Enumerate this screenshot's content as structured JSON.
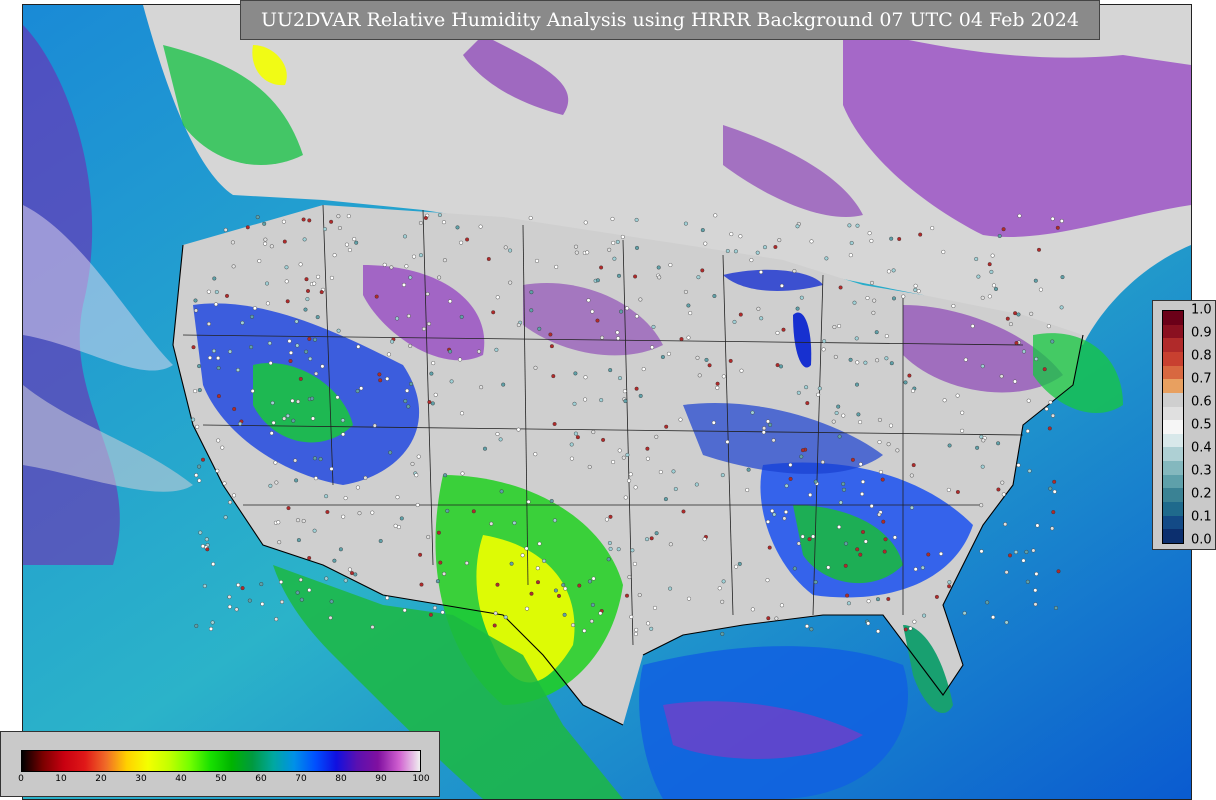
{
  "title": "UU2DVAR Relative Humidity Analysis using HRRR Background 07 UTC 04 Feb 2024",
  "map": {
    "land_color": "#cfcfcf",
    "ocean_gradient": [
      "#1a8ad6",
      "#2bb3c9",
      "#0a5bd0"
    ],
    "station_marker_color": "#ffffff"
  },
  "bottom_legend": {
    "ticks": [
      "0",
      "10",
      "20",
      "30",
      "40",
      "50",
      "60",
      "70",
      "80",
      "90",
      "100"
    ],
    "colors": [
      "#000000",
      "#7a0000",
      "#c80010",
      "#e01818",
      "#f06a28",
      "#ffd000",
      "#f4ff00",
      "#c4ff00",
      "#74ff00",
      "#18e000",
      "#00b400",
      "#009a40",
      "#00a8a0",
      "#0090e8",
      "#0050ff",
      "#1010e0",
      "#5a10b0",
      "#8010a0",
      "#d060d0",
      "#f0f0f0"
    ]
  },
  "right_legend": {
    "ticks": [
      "1.0",
      "0.9",
      "0.8",
      "0.7",
      "0.6",
      "0.5",
      "0.4",
      "0.3",
      "0.2",
      "0.1",
      "0.0"
    ],
    "colors": [
      "#6b0018",
      "#8a1020",
      "#b02a2a",
      "#c84030",
      "#d86840",
      "#e8a060",
      "#cfcfcf",
      "#e0e0e0",
      "#f6f6f6",
      "#d8e8ea",
      "#aed0d4",
      "#84b8be",
      "#5ea0aa",
      "#3a8294",
      "#1f6a8c",
      "#134a86",
      "#0c2f6e"
    ]
  }
}
